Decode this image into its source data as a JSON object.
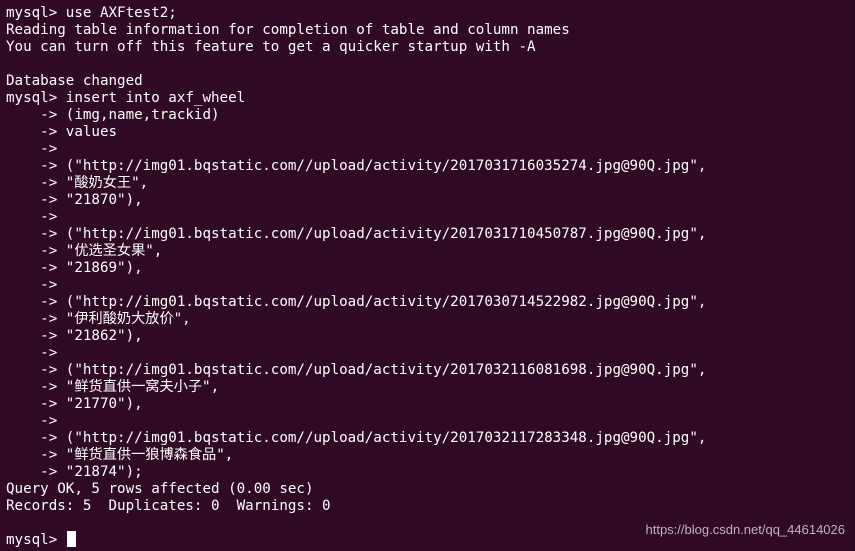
{
  "terminal": {
    "lines": [
      "mysql> use AXFtest2;",
      "Reading table information for completion of table and column names",
      "You can turn off this feature to get a quicker startup with -A",
      "",
      "Database changed",
      "mysql> insert into axf_wheel",
      "    -> (img,name,trackid)",
      "    -> values",
      "    ->",
      "    -> (\"http://img01.bqstatic.com//upload/activity/2017031716035274.jpg@90Q.jpg\",",
      "    -> \"酸奶女王\",",
      "    -> \"21870\"),",
      "    ->",
      "    -> (\"http://img01.bqstatic.com//upload/activity/2017031710450787.jpg@90Q.jpg\",",
      "    -> \"优选圣女果\",",
      "    -> \"21869\"),",
      "    ->",
      "    -> (\"http://img01.bqstatic.com//upload/activity/2017030714522982.jpg@90Q.jpg\",",
      "    -> \"伊利酸奶大放价\",",
      "    -> \"21862\"),",
      "    ->",
      "    -> (\"http://img01.bqstatic.com//upload/activity/2017032116081698.jpg@90Q.jpg\",",
      "    -> \"鲜货直供一窝夫小子\",",
      "    -> \"21770\"),",
      "    ->",
      "    -> (\"http://img01.bqstatic.com//upload/activity/2017032117283348.jpg@90Q.jpg\",",
      "    -> \"鲜货直供一狼博森食品\",",
      "    -> \"21874\");",
      "Query OK, 5 rows affected (0.00 sec)",
      "Records: 5  Duplicates: 0  Warnings: 0"
    ],
    "prompt": "mysql> "
  },
  "watermark": "https://blog.csdn.net/qq_44614026",
  "colors": {
    "background": "#300a24",
    "foreground": "#ffffff"
  }
}
